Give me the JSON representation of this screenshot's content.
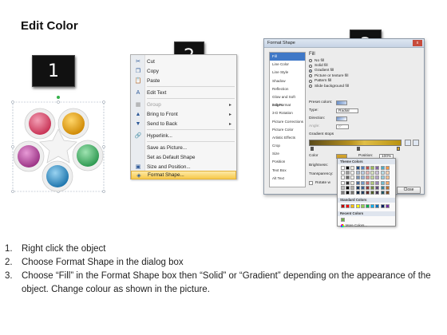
{
  "title": "Edit Color",
  "badges": [
    "1",
    "2",
    "3"
  ],
  "shape": {
    "colors": {
      "pink": "#d84a6a",
      "gold": "#e2a11a",
      "green": "#45b36a",
      "blue": "#2f8fc6",
      "violet": "#b74e9e"
    },
    "selection_handle_color": "#35b04a"
  },
  "context_menu": {
    "items": [
      {
        "icon": "✂",
        "label": "Cut",
        "disabled": false,
        "submenu": false
      },
      {
        "icon": "❐",
        "label": "Copy",
        "disabled": false,
        "submenu": false
      },
      {
        "icon": "📋",
        "label": "Paste",
        "disabled": false,
        "submenu": false
      },
      {
        "icon": "A",
        "label": "Edit Text",
        "disabled": false,
        "submenu": false
      },
      {
        "icon": "▦",
        "label": "Group",
        "disabled": true,
        "submenu": true
      },
      {
        "icon": "▲",
        "label": "Bring to Front",
        "disabled": false,
        "submenu": true
      },
      {
        "icon": "▼",
        "label": "Send to Back",
        "disabled": false,
        "submenu": true
      },
      {
        "icon": "🔗",
        "label": "Hyperlink...",
        "disabled": false,
        "submenu": false
      },
      {
        "icon": "",
        "label": "Save as Picture...",
        "disabled": false,
        "submenu": false
      },
      {
        "icon": "",
        "label": "Set as Default Shape",
        "disabled": false,
        "submenu": false
      },
      {
        "icon": "▣",
        "label": "Size and Position...",
        "disabled": false,
        "submenu": false
      },
      {
        "icon": "◈",
        "label": "Format Shape...",
        "disabled": false,
        "submenu": false,
        "highlight": true
      }
    ]
  },
  "format_dialog": {
    "title": "Format Shape",
    "close_glyph": "x",
    "categories": [
      "Fill",
      "Line Color",
      "Line Style",
      "Shadow",
      "Reflection",
      "Glow and Soft Edges",
      "3-D Format",
      "3-D Rotation",
      "Picture Corrections",
      "Picture Color",
      "Artistic Effects",
      "Crop",
      "Size",
      "Position",
      "Text Box",
      "Alt Text"
    ],
    "selected_category": "Fill",
    "fill_header": "Fill",
    "fill_options": [
      {
        "label": "No fill",
        "selected": false
      },
      {
        "label": "Solid fill",
        "selected": false
      },
      {
        "label": "Gradient fill",
        "selected": true
      },
      {
        "label": "Picture or texture fill",
        "selected": false
      },
      {
        "label": "Pattern fill",
        "selected": false
      },
      {
        "label": "Slide background fill",
        "selected": false
      }
    ],
    "preset_colors_label": "Preset colors:",
    "type_label": "Type:",
    "type_value": "Radial",
    "direction_label": "Direction:",
    "angle_label": "Angle:",
    "angle_value": "0°",
    "gradient_stops_label": "Gradient stops",
    "color_label": "Color",
    "position_label": "Position:",
    "position_value": "100%",
    "brightness_label": "Brightness:",
    "transparency_label": "Transparency:",
    "rotate_label": "Rotate w",
    "close_button": "Close",
    "picker": {
      "theme_colors_label": "Theme Colors",
      "standard_colors_label": "Standard Colors",
      "recent_colors_label": "Recent Colors",
      "more_colors_label": "More Colors...",
      "theme_top": [
        "#ffffff",
        "#000000",
        "#eeece1",
        "#1f497d",
        "#4f81bd",
        "#c0504d",
        "#9bbb59",
        "#8064a2",
        "#4bacc6",
        "#f79646"
      ],
      "standard": [
        "#c00000",
        "#ff0000",
        "#ffc000",
        "#ffff00",
        "#92d050",
        "#00b050",
        "#00b0f0",
        "#0070c0",
        "#002060",
        "#7030a0"
      ],
      "recent": [
        "#70ad47"
      ]
    }
  },
  "steps": [
    {
      "n": "1.",
      "text": "Right click the object"
    },
    {
      "n": "2.",
      "text": "Choose Format Shape in the dialog box"
    },
    {
      "n": "3.",
      "text": "Choose “Fill” in the Format Shape box then “Solid” or “Gradient” depending on the appearance of the object. Change colour as shown in the picture."
    }
  ]
}
